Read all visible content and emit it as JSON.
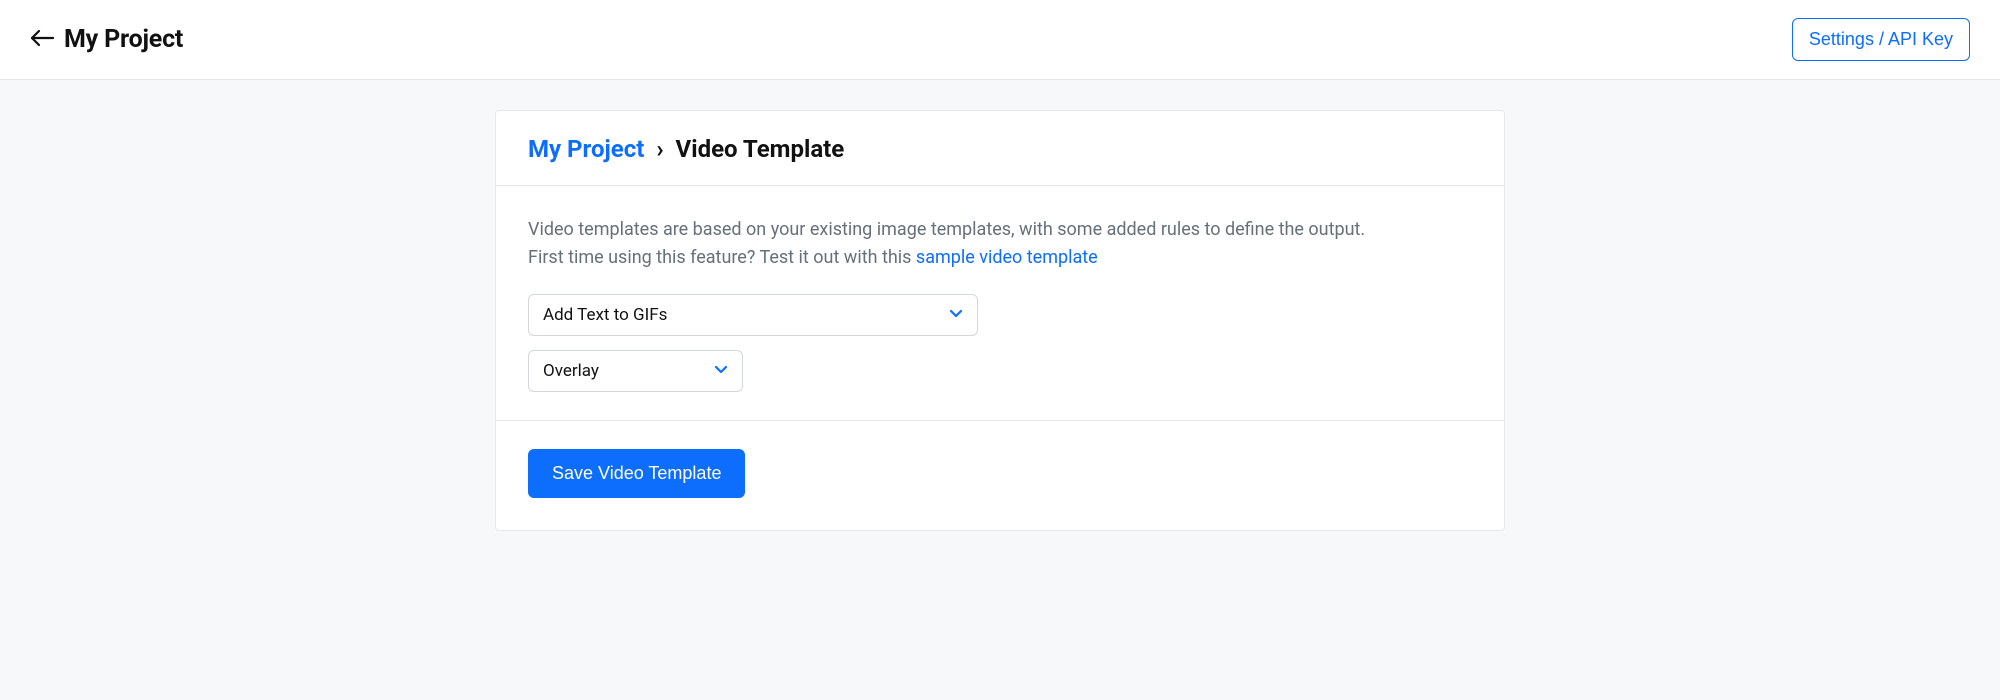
{
  "header": {
    "title": "My Project",
    "settings_label": "Settings / API Key"
  },
  "breadcrumb": {
    "project": "My Project",
    "separator": "›",
    "current": "Video Template"
  },
  "description": {
    "line1": "Video templates are based on your existing image templates, with some added rules to define the output.",
    "line2_prefix": "First time using this feature? Test it out with this ",
    "sample_link": "sample video template"
  },
  "selects": {
    "template": "Add Text to GIFs",
    "mode": "Overlay"
  },
  "actions": {
    "save_label": "Save Video Template"
  }
}
